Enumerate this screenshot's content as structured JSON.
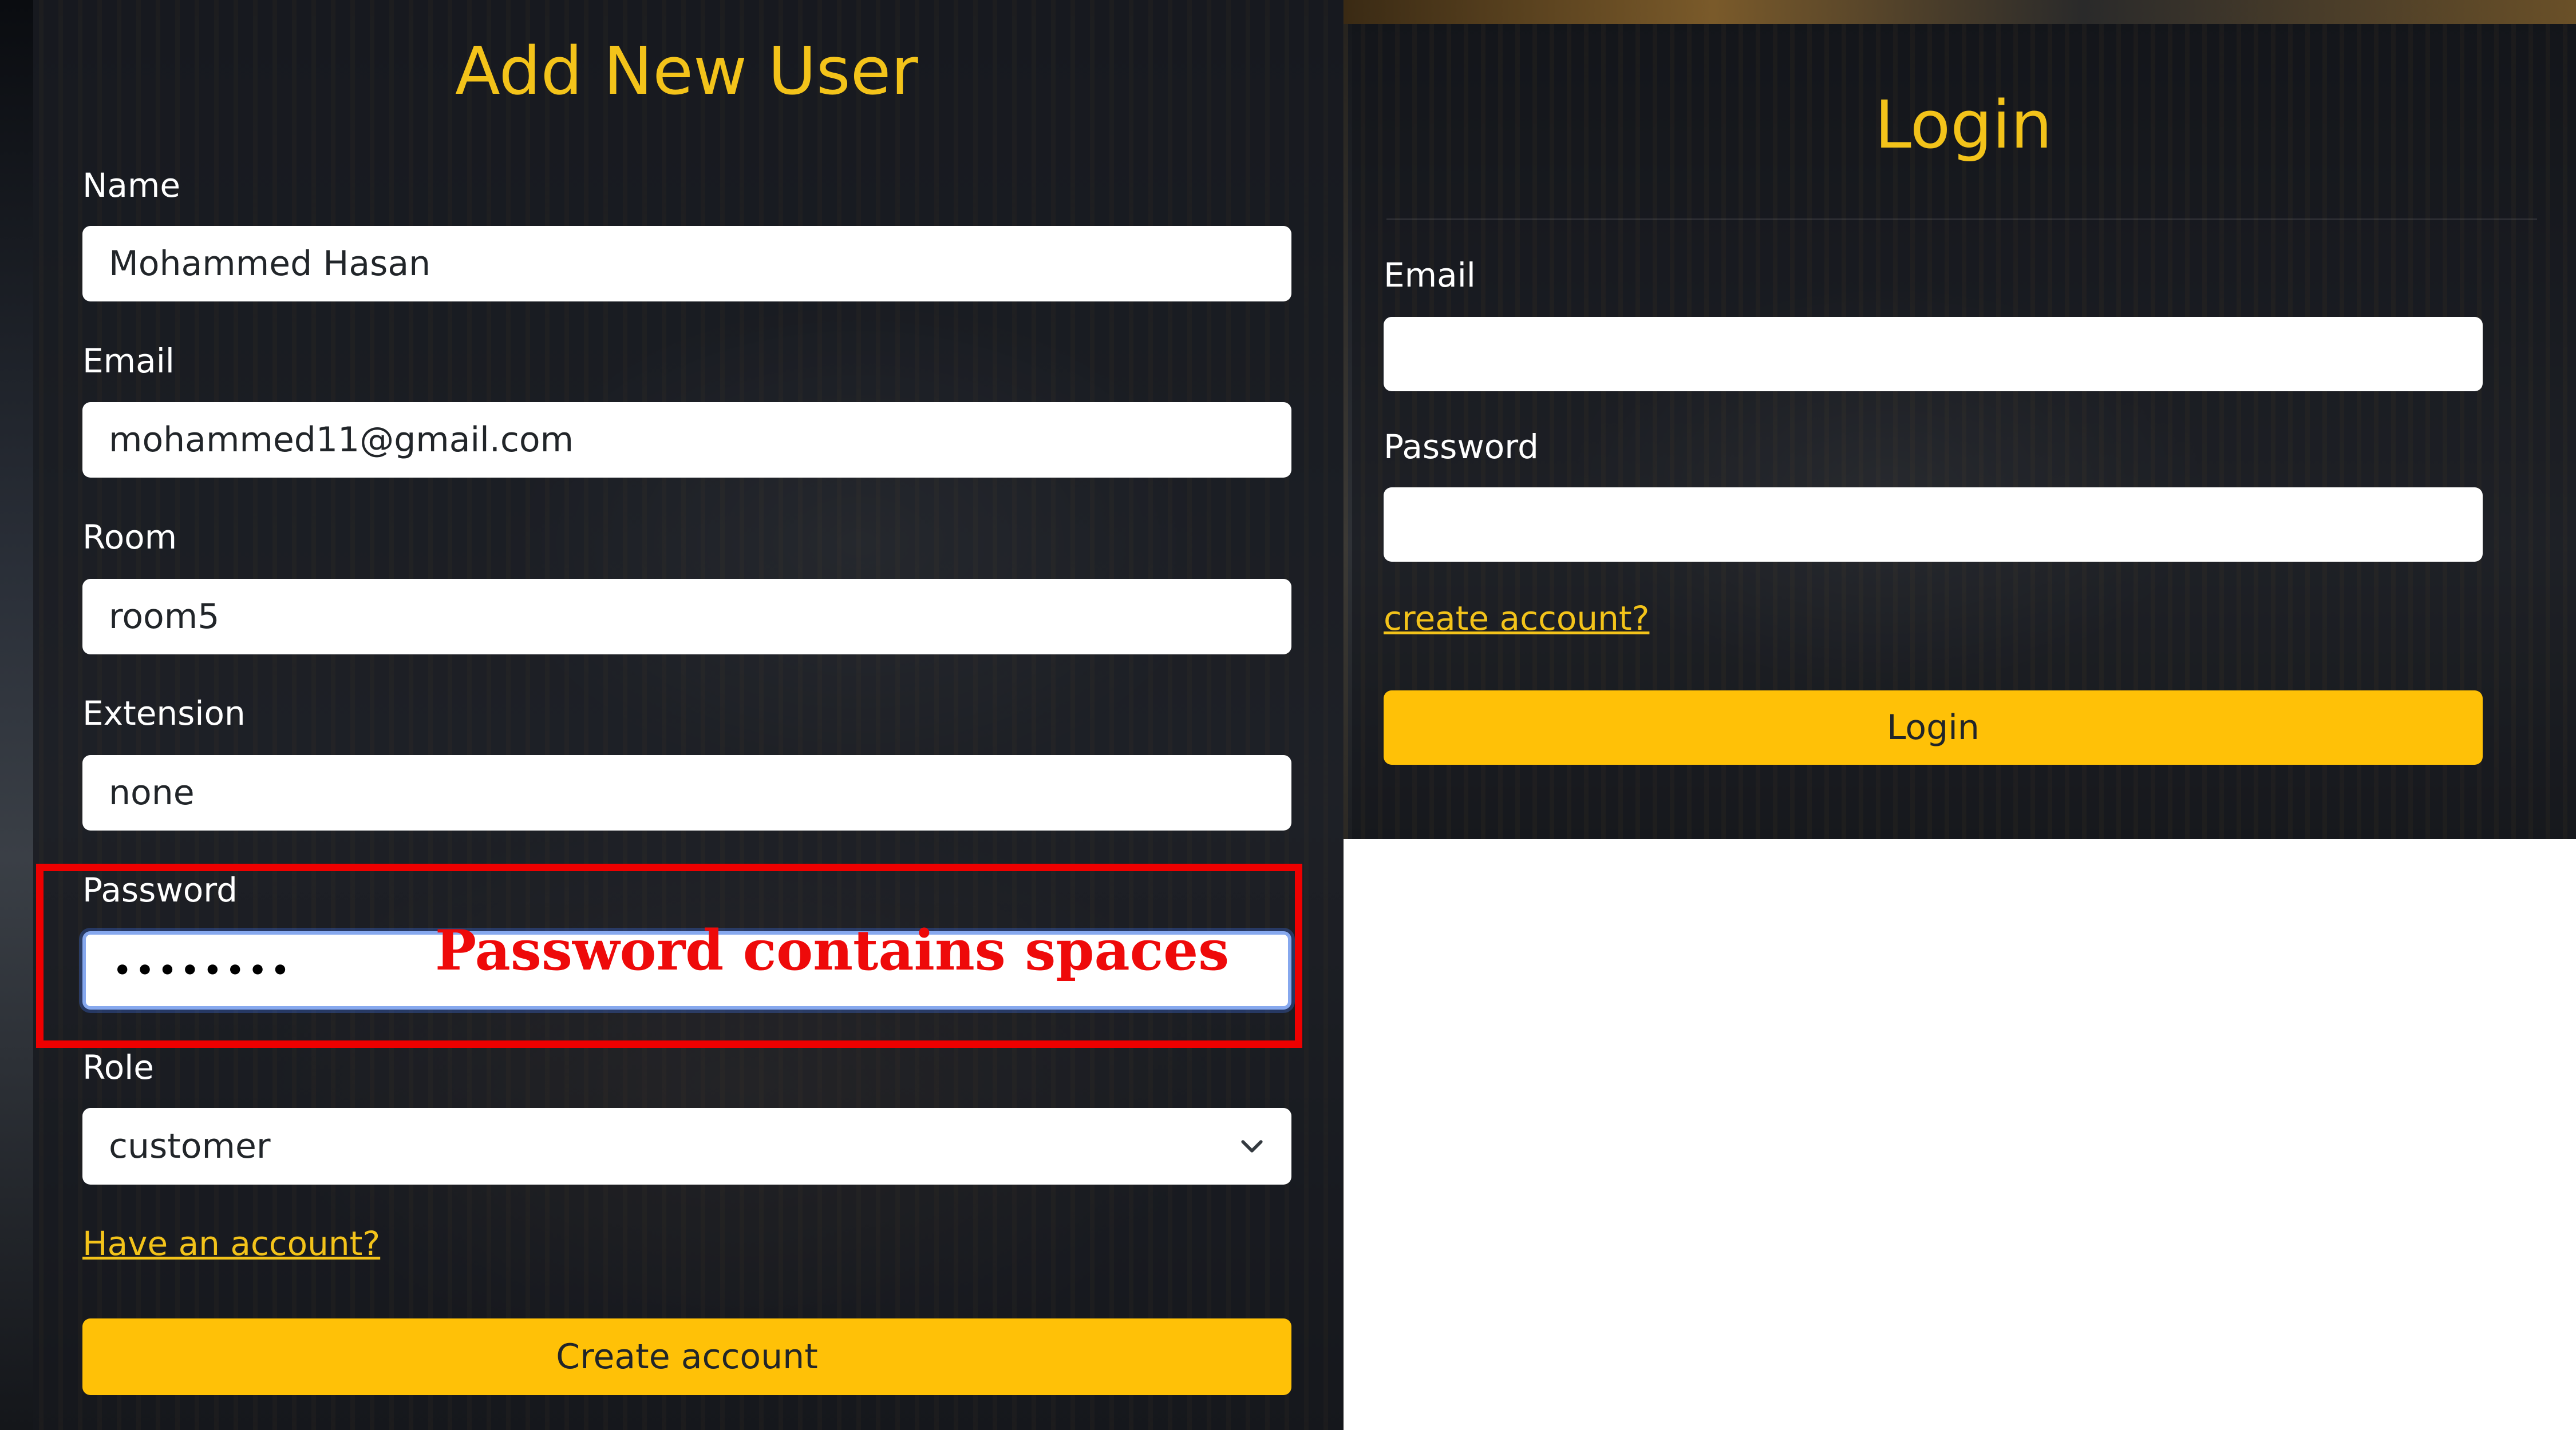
{
  "colors": {
    "accent": "#ffc107",
    "title_color": "#f3c31a",
    "annotation_red": "#ee0000",
    "panel_overlay": "rgba(18,20,26,0.55)"
  },
  "signup": {
    "title": "Add New User",
    "name": {
      "label": "Name",
      "value": "Mohammed Hasan"
    },
    "email": {
      "label": "Email",
      "value": "mohammed11@gmail.com"
    },
    "room": {
      "label": "Room",
      "value": "room5"
    },
    "extension": {
      "label": "Extension",
      "value": "none"
    },
    "password": {
      "label": "Password",
      "value": "••••••••"
    },
    "role": {
      "label": "Role",
      "selected": "customer",
      "icon": "chevron-down-icon"
    },
    "have_account_link": "Have an account?",
    "submit_label": "Create account"
  },
  "login": {
    "title": "Login",
    "email": {
      "label": "Email",
      "value": ""
    },
    "password": {
      "label": "Password",
      "value": ""
    },
    "create_account_link": "create account?",
    "submit_label": "Login"
  },
  "annotation": {
    "text": "Password contains spaces"
  }
}
